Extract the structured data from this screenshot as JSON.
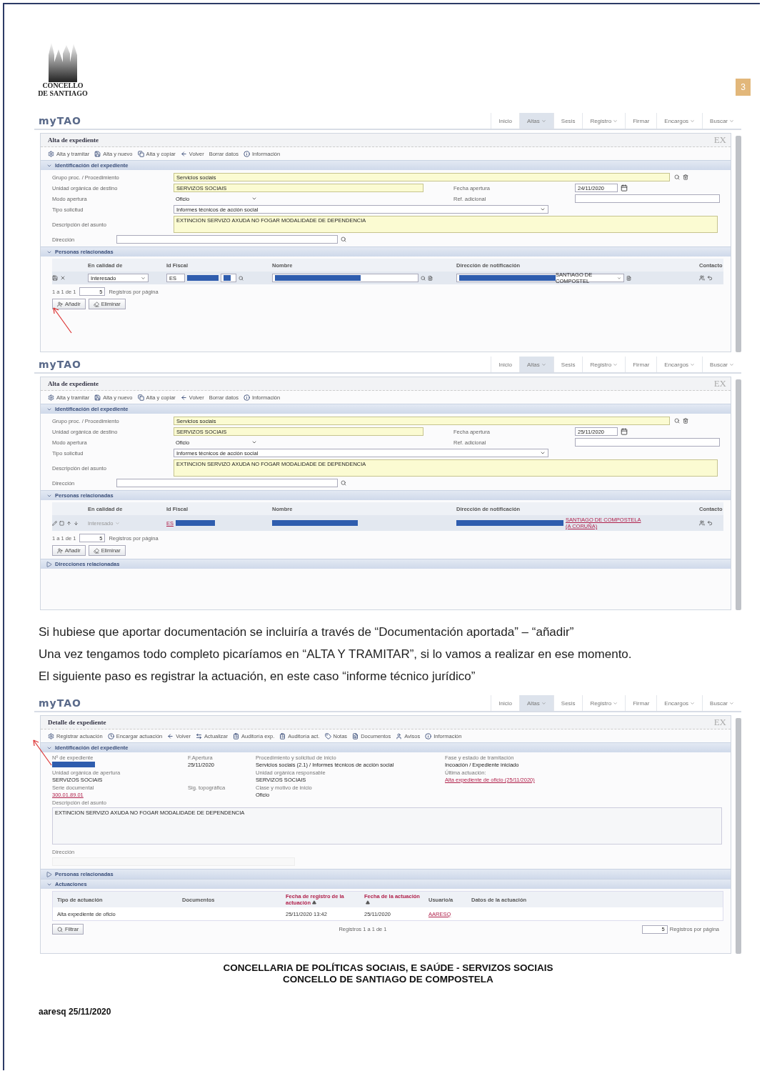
{
  "logo": {
    "text": "CONCELLO DE SANTIAGO"
  },
  "page_number": "3",
  "screens": [
    {
      "kind": "form",
      "brand": "myTAO",
      "pointer_arrow": true,
      "nav": [
        {
          "label": "Inicio",
          "dropdown": false,
          "selected": false
        },
        {
          "label": "Altas",
          "dropdown": true,
          "selected": true
        },
        {
          "label": "Sesis",
          "dropdown": false,
          "selected": false
        },
        {
          "label": "Registro",
          "dropdown": true,
          "selected": false
        },
        {
          "label": "Firmar",
          "dropdown": false,
          "selected": false
        },
        {
          "label": "Encargos",
          "dropdown": true,
          "selected": false
        },
        {
          "label": "Buscar",
          "dropdown": true,
          "selected": false
        }
      ],
      "title": "Alta de expediente",
      "code": "EX",
      "toolbar": [
        {
          "kind": "gear",
          "label": "Alta y tramitar"
        },
        {
          "kind": "save",
          "label": "Alta y nuevo"
        },
        {
          "kind": "copy",
          "label": "Alta y copiar"
        },
        {
          "kind": "back",
          "label": "Volver"
        },
        {
          "kind": "plain",
          "label": "Borrar datos"
        },
        {
          "kind": "info",
          "label": "Información"
        }
      ],
      "section": {
        "title": "Identificación del expediente",
        "expanded": true
      },
      "group": {
        "label": "Grupo proc. / Procedimiento",
        "value": "Servicios sociais"
      },
      "unit": {
        "label": "Unidad orgánica de destino",
        "value": "SERVIZOS SOCIAIS"
      },
      "date": {
        "label": "Fecha apertura",
        "value": "24/11/2020"
      },
      "mode": {
        "label": "Modo apertura",
        "value": "Oficio"
      },
      "ref": {
        "label": "Ref. adicional"
      },
      "type": {
        "label": "Tipo solicitud",
        "value": "Informes técnicos de acción social"
      },
      "description": {
        "label": "Descripción del asunto",
        "value": "EXTINCION SERVIZO AXUDA NO FOGAR MODALIDADE DE DEPENDENCIA"
      },
      "address": {
        "label": "Dirección"
      },
      "people": {
        "title": "Personas relacionadas",
        "expanded": true,
        "columns": [
          "En calidad de",
          "Id Fiscal",
          "Nombre",
          "Dirección de notificación",
          "Contacto"
        ],
        "rows": [
          {
            "kind": "edit",
            "role": "Interesado",
            "id_prefix": "ES",
            "address": "SANTIAGO DE COMPOSTEL"
          }
        ],
        "pager": "1 a 1 de 1",
        "page_size": "5",
        "page_size_label": "Registros por página",
        "buttons": [
          {
            "kind": "add",
            "label": "Añadir"
          },
          {
            "kind": "erase",
            "label": "Eliminar"
          }
        ]
      }
    },
    {
      "kind": "form",
      "brand": "myTAO",
      "pointer_arrow": false,
      "nav": [
        {
          "label": "Inicio",
          "dropdown": false,
          "selected": false
        },
        {
          "label": "Altas",
          "dropdown": true,
          "selected": true
        },
        {
          "label": "Sesis",
          "dropdown": false,
          "selected": false
        },
        {
          "label": "Registro",
          "dropdown": true,
          "selected": false
        },
        {
          "label": "Firmar",
          "dropdown": false,
          "selected": false
        },
        {
          "label": "Encargos",
          "dropdown": true,
          "selected": false
        },
        {
          "label": "Buscar",
          "dropdown": true,
          "selected": false
        }
      ],
      "title": "Alta de expediente",
      "code": "EX",
      "toolbar": [
        {
          "kind": "gear",
          "label": "Alta y tramitar"
        },
        {
          "kind": "save",
          "label": "Alta y nuevo"
        },
        {
          "kind": "copy",
          "label": "Alta y copiar"
        },
        {
          "kind": "back",
          "label": "Volver"
        },
        {
          "kind": "plain",
          "label": "Borrar datos"
        },
        {
          "kind": "info",
          "label": "Información"
        }
      ],
      "section": {
        "title": "Identificación del expediente",
        "expanded": true
      },
      "group": {
        "label": "Grupo proc. / Procedimiento",
        "value": "Servicios sociais"
      },
      "unit": {
        "label": "Unidad orgánica de destino",
        "value": "SERVIZOS SOCIAIS"
      },
      "date": {
        "label": "Fecha apertura",
        "value": "25/11/2020"
      },
      "mode": {
        "label": "Modo apertura",
        "value": "Oficio"
      },
      "ref": {
        "label": "Ref. adicional"
      },
      "type": {
        "label": "Tipo solicitud",
        "value": "Informes técnicos de acción social"
      },
      "description": {
        "label": "Descripción del asunto",
        "value": "EXTINCION SERVIZO AXUDA NO FOGAR MODALIDADE DE DEPENDENCIA"
      },
      "address": {
        "label": "Dirección"
      },
      "people": {
        "title": "Personas relacionadas",
        "expanded": true,
        "columns": [
          "En calidad de",
          "Id Fiscal",
          "Nombre",
          "Dirección de notificación",
          "Contacto"
        ],
        "rows": [
          {
            "kind": "view",
            "role": "Interesado",
            "id_prefix": "ES",
            "address": "SANTIAGO DE COMPOSTELA (A CORUÑA)"
          }
        ],
        "pager": "1 a 1 de 1",
        "page_size": "5",
        "page_size_label": "Registros por página",
        "buttons": [
          {
            "kind": "add",
            "label": "Añadir"
          },
          {
            "kind": "erase",
            "label": "Eliminar"
          }
        ]
      },
      "extra_section": {
        "title": "Direcciones relacionadas",
        "expanded": false
      }
    }
  ],
  "paragraphs": [
    "Si hubiese que aportar documentación se incluiría a través de “Documentación aportada” – “añadir”",
    "Una vez tengamos todo completo picaríamos en “ALTA Y TRAMITAR”, si lo vamos a realizar en ese momento.",
    "El siguiente paso es registrar la actuación, en este caso “informe técnico jurídico”"
  ],
  "detail": {
    "brand": "myTAO",
    "pointer_arrow": true,
    "nav": [
      {
        "label": "Inicio",
        "dropdown": false,
        "selected": false
      },
      {
        "label": "Altas",
        "dropdown": true,
        "selected": true
      },
      {
        "label": "Sesis",
        "dropdown": false,
        "selected": false
      },
      {
        "label": "Registro",
        "dropdown": true,
        "selected": false
      },
      {
        "label": "Firmar",
        "dropdown": false,
        "selected": false
      },
      {
        "label": "Encargos",
        "dropdown": true,
        "selected": false
      },
      {
        "label": "Buscar",
        "dropdown": true,
        "selected": false
      }
    ],
    "title": "Detalle de expediente",
    "code": "EX",
    "toolbar": [
      {
        "kind": "gear",
        "label": "Registrar actuación"
      },
      {
        "kind": "clock",
        "label": "Encargar actuación"
      },
      {
        "kind": "back",
        "label": "Volver"
      },
      {
        "kind": "refresh",
        "label": "Actualizar"
      },
      {
        "kind": "audit",
        "label": "Auditoría exp."
      },
      {
        "kind": "audit",
        "label": "Auditoría act."
      },
      {
        "kind": "tag",
        "label": "Notas"
      },
      {
        "kind": "doc",
        "label": "Documentos"
      },
      {
        "kind": "user",
        "label": "Avisos"
      },
      {
        "kind": "info",
        "label": "Información"
      }
    ],
    "section": {
      "title": "Identificación del expediente",
      "expanded": true
    },
    "field_rows": [
      [
        {
          "label": "Nº de expediente",
          "kind": "redacted"
        },
        {
          "label": "F.Apertura",
          "value": "25/11/2020",
          "kind": "text"
        },
        {
          "label": "Procedimiento y solicitud de inicio",
          "value": "Servicios sociais (2.1) / Informes técnicos de acción social",
          "kind": "text"
        },
        {
          "label": "Fase y estado de tramitación",
          "value": "Incoación / Expediente iniciado",
          "kind": "text"
        }
      ],
      [
        {
          "label": "Unidad orgánica de apertura",
          "value": "SERVIZOS SOCIAIS",
          "kind": "text"
        },
        {
          "label": "Unidad orgánica responsable",
          "value": "SERVIZOS SOCIAIS",
          "kind": "text"
        },
        {
          "label": "Última actuación:",
          "value": "Alta expediente de oficio (25/11/2020)",
          "kind": "link"
        }
      ],
      [
        {
          "label": "Serie documental",
          "value": "300.01.89.01",
          "kind": "link"
        },
        {
          "label": "Sig. topográfica",
          "kind": "empty"
        },
        {
          "label": "Clase y motivo de inicio",
          "value": "Oficio",
          "kind": "text"
        }
      ]
    ],
    "description": {
      "label": "Descripción del asunto",
      "value": "EXTINCION SERVIZO AXUDA NO FOGAR MODALIDADE DE DEPENDENCIA"
    },
    "address": {
      "label": "Dirección"
    },
    "sections": [
      {
        "title": "Personas relacionadas",
        "expanded": false
      },
      {
        "title": "Actuaciones",
        "expanded": true
      }
    ],
    "columns": [
      {
        "label": "Tipo de actuación",
        "sortable": false
      },
      {
        "label": "Documentos",
        "sortable": false
      },
      {
        "label": "Fecha de registro de la actuación",
        "sortable": true
      },
      {
        "label": "Fecha de la actuación",
        "sortable": true
      },
      {
        "label": "Usuario/a",
        "sortable": false
      },
      {
        "label": "Datos de la actuación",
        "sortable": false
      }
    ],
    "rows": [
      {
        "cells": [
          {
            "kind": "text",
            "value": "Alta expediente de oficio"
          },
          {
            "kind": "empty"
          },
          {
            "kind": "text",
            "value": "25/11/2020 13:42"
          },
          {
            "kind": "text",
            "value": "25/11/2020"
          },
          {
            "kind": "link",
            "value": "AARESQ"
          },
          {
            "kind": "empty"
          }
        ]
      }
    ],
    "filter_button": "Filtrar",
    "pager": "Registros 1 a 1 de 1",
    "page_size": "5",
    "page_size_label": "Registros por página"
  },
  "footer": [
    "CONCELLARIA DE POLÍTICAS SOCIAIS, E SAÚDE - SERVIZOS SOCIAIS",
    "CONCELLO DE SANTIAGO DE COMPOSTELA"
  ],
  "signature": "aaresq 25/11/2020"
}
